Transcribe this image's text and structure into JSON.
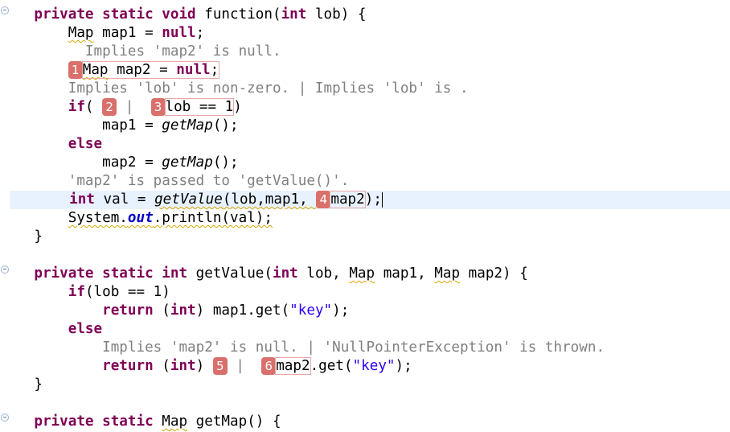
{
  "editor": {
    "lines": [
      {
        "tokens": [
          {
            "t": "    "
          },
          {
            "t": "private static void",
            "c": "kw"
          },
          {
            "t": " function("
          },
          {
            "t": "int",
            "c": "kw"
          },
          {
            "t": " lob) {"
          }
        ]
      },
      {
        "tokens": [
          {
            "t": "        "
          },
          {
            "t": "Map",
            "c": "sq"
          },
          {
            "t": " map1 = "
          },
          {
            "t": "null",
            "c": "kw"
          },
          {
            "t": ";"
          }
        ]
      },
      {
        "tokens": [
          {
            "t": "          Implies 'map2' is null.",
            "c": "ann"
          }
        ]
      },
      {
        "tokens": [
          {
            "t": "        "
          },
          {
            "t": "1",
            "c": "badge"
          },
          {
            "t": "Map map2 = null;",
            "c": "boxed",
            "parts": [
              {
                "t": "Map",
                "c": "sq"
              },
              {
                "t": " map2 = "
              },
              {
                "t": "null",
                "c": "kw"
              },
              {
                "t": ";"
              }
            ]
          }
        ]
      },
      {
        "tokens": [
          {
            "t": "        Implies 'lob' is non-zero. | Implies 'lob' is .",
            "c": "ann"
          }
        ]
      },
      {
        "tokens": [
          {
            "t": "        "
          },
          {
            "t": "if",
            "c": "kw"
          },
          {
            "t": "( "
          },
          {
            "t": "2",
            "c": "badge"
          },
          {
            "t": " | ",
            "c": "ann"
          },
          {
            "t": " "
          },
          {
            "t": "3",
            "c": "badge"
          },
          {
            "t": "lob == 1",
            "c": "boxed"
          },
          {
            "t": ")"
          }
        ]
      },
      {
        "tokens": [
          {
            "t": "            map1 = "
          },
          {
            "t": "getMap",
            "c": "ital"
          },
          {
            "t": "();"
          }
        ]
      },
      {
        "tokens": [
          {
            "t": "        "
          },
          {
            "t": "else",
            "c": "kw"
          }
        ]
      },
      {
        "tokens": [
          {
            "t": "            map2 = "
          },
          {
            "t": "getMap",
            "c": "ital"
          },
          {
            "t": "();"
          }
        ]
      },
      {
        "tokens": [
          {
            "t": "        'map2' is passed to 'getValue()'.",
            "c": "ann"
          }
        ]
      },
      {
        "current": true,
        "tokens": [
          {
            "t": "       "
          },
          {
            "t": "int",
            "c": "kw"
          },
          {
            "t": " val = "
          },
          {
            "t": "getValue",
            "c": "ital sq"
          },
          {
            "t": "(lob,map1, ",
            "c": "sq"
          },
          {
            "t": "4",
            "c": "badge"
          },
          {
            "t": "map2",
            "c": "boxed"
          },
          {
            "t": ");"
          },
          {
            "t": "",
            "c": "caret"
          }
        ]
      },
      {
        "tokens": [
          {
            "t": "        "
          },
          {
            "t": "System.",
            "c": "sq"
          },
          {
            "t": "out",
            "c": "field sq"
          },
          {
            "t": ".println(val);",
            "c": "sq"
          }
        ]
      },
      {
        "tokens": [
          {
            "t": "    }"
          }
        ]
      },
      {
        "tokens": [
          {
            "t": ""
          }
        ]
      },
      {
        "tokens": [
          {
            "t": "    "
          },
          {
            "t": "private static int",
            "c": "kw"
          },
          {
            "t": " getValue("
          },
          {
            "t": "int",
            "c": "kw"
          },
          {
            "t": " lob, "
          },
          {
            "t": "Map",
            "c": "sq"
          },
          {
            "t": " map1, "
          },
          {
            "t": "Map",
            "c": "sq"
          },
          {
            "t": " map2) {"
          }
        ]
      },
      {
        "tokens": [
          {
            "t": "        "
          },
          {
            "t": "if",
            "c": "kw"
          },
          {
            "t": "(lob == 1)"
          }
        ]
      },
      {
        "tokens": [
          {
            "t": "            "
          },
          {
            "t": "return",
            "c": "kw"
          },
          {
            "t": " ("
          },
          {
            "t": "int",
            "c": "kw"
          },
          {
            "t": ") map1.get("
          },
          {
            "t": "\"key\"",
            "c": "str"
          },
          {
            "t": ");"
          }
        ]
      },
      {
        "tokens": [
          {
            "t": "        "
          },
          {
            "t": "else",
            "c": "kw"
          }
        ]
      },
      {
        "tokens": [
          {
            "t": "            Implies 'map2' is null. | 'NullPointerException' is thrown.",
            "c": "ann"
          }
        ]
      },
      {
        "tokens": [
          {
            "t": "            "
          },
          {
            "t": "return",
            "c": "kw"
          },
          {
            "t": " ("
          },
          {
            "t": "int",
            "c": "kw"
          },
          {
            "t": ") "
          },
          {
            "t": "5",
            "c": "badge"
          },
          {
            "t": " | ",
            "c": "ann"
          },
          {
            "t": " "
          },
          {
            "t": "6",
            "c": "badge"
          },
          {
            "t": "map2",
            "c": "boxed"
          },
          {
            "t": ".get("
          },
          {
            "t": "\"key\"",
            "c": "str"
          },
          {
            "t": ");"
          }
        ]
      },
      {
        "tokens": [
          {
            "t": "    }"
          }
        ]
      },
      {
        "tokens": [
          {
            "t": ""
          }
        ]
      },
      {
        "tokens": [
          {
            "t": "    "
          },
          {
            "t": "private static",
            "c": "kw"
          },
          {
            "t": " "
          },
          {
            "t": "Map",
            "c": "sq"
          },
          {
            "t": " getMap() {"
          }
        ]
      }
    ]
  },
  "colors": {
    "keyword": "#7f0055",
    "string": "#2a00ff",
    "annotation": "#808080",
    "badge": "#d9706b",
    "current_line": "#e8f2fe"
  }
}
